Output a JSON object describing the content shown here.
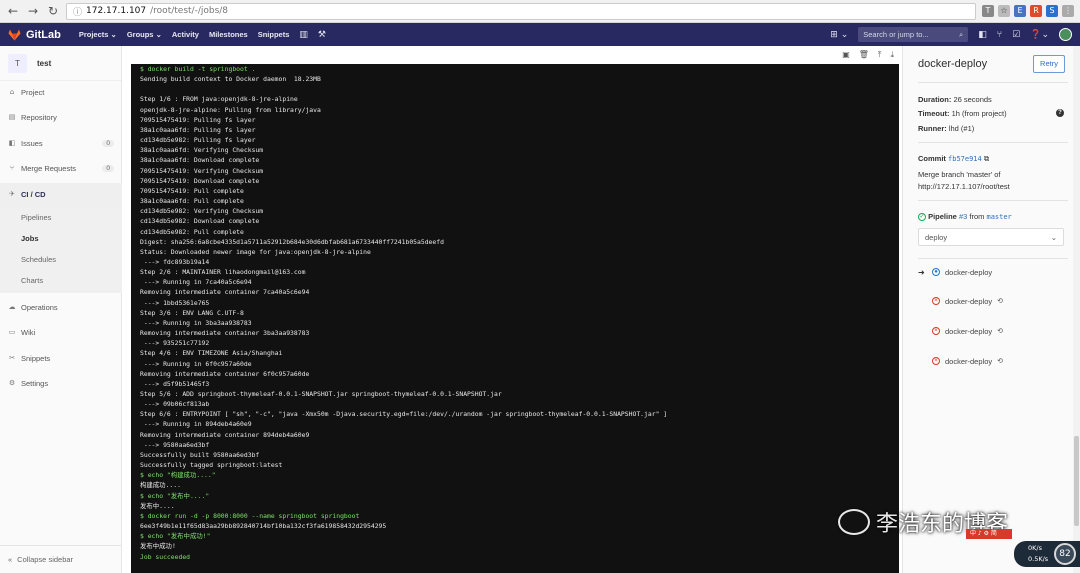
{
  "browser": {
    "url_host": "172.17.1.107",
    "url_path": "/root/test/-/jobs/8",
    "back_glyph": "←",
    "forward_glyph": "→",
    "reload_glyph": "↻"
  },
  "header": {
    "brand": "GitLab",
    "nav": [
      "Projects ⌄",
      "Groups ⌄",
      "Activity",
      "Milestones",
      "Snippets"
    ],
    "search_placeholder": "Search or jump to...",
    "accent": "#292961"
  },
  "sidebar": {
    "project_initial": "T",
    "project_name": "test",
    "items": [
      {
        "label": "Project",
        "icon": "house-icon"
      },
      {
        "label": "Repository",
        "icon": "book-icon"
      },
      {
        "label": "Issues",
        "icon": "issues-icon",
        "count": "0"
      },
      {
        "label": "Merge Requests",
        "icon": "merge-icon",
        "count": "0"
      },
      {
        "label": "CI / CD",
        "icon": "rocket-icon"
      },
      {
        "label": "Operations",
        "icon": "cloud-icon"
      },
      {
        "label": "Wiki",
        "icon": "wiki-icon"
      },
      {
        "label": "Snippets",
        "icon": "scissors-icon"
      },
      {
        "label": "Settings",
        "icon": "gear-icon"
      }
    ],
    "subitems": [
      "Pipelines",
      "Jobs",
      "Schedules",
      "Charts"
    ],
    "collapse_label": "Collapse sidebar"
  },
  "log": {
    "lines": [
      {
        "text": "$ docker build -t springboot .",
        "green": true
      },
      {
        "text": "Sending build context to Docker daemon  18.23MB",
        "green": false
      },
      {
        "text": "",
        "green": false
      },
      {
        "text": "Step 1/6 : FROM java:openjdk-8-jre-alpine",
        "green": false
      },
      {
        "text": "openjdk-8-jre-alpine: Pulling from library/java",
        "green": false
      },
      {
        "text": "709515475419: Pulling fs layer",
        "green": false
      },
      {
        "text": "38a1c0aaa6fd: Pulling fs layer",
        "green": false
      },
      {
        "text": "cd134db5e982: Pulling fs layer",
        "green": false
      },
      {
        "text": "38a1c0aaa6fd: Verifying Checksum",
        "green": false
      },
      {
        "text": "38a1c0aaa6fd: Download complete",
        "green": false
      },
      {
        "text": "709515475419: Verifying Checksum",
        "green": false
      },
      {
        "text": "709515475419: Download complete",
        "green": false
      },
      {
        "text": "709515475419: Pull complete",
        "green": false
      },
      {
        "text": "38a1c0aaa6fd: Pull complete",
        "green": false
      },
      {
        "text": "cd134db5e982: Verifying Checksum",
        "green": false
      },
      {
        "text": "cd134db5e982: Download complete",
        "green": false
      },
      {
        "text": "cd134db5e982: Pull complete",
        "green": false
      },
      {
        "text": "Digest: sha256:6a8cbe4335d1a5711a52912b684e30d6dbfab681a6733440ff7241b05a5deefd",
        "green": false
      },
      {
        "text": "Status: Downloaded newer image for java:openjdk-8-jre-alpine",
        "green": false
      },
      {
        "text": " ---> fdc893b19a14",
        "green": false
      },
      {
        "text": "Step 2/6 : MAINTAINER lihaodongmail@163.com",
        "green": false
      },
      {
        "text": " ---> Running in 7ca40a5c6e94",
        "green": false
      },
      {
        "text": "Removing intermediate container 7ca40a5c6e94",
        "green": false
      },
      {
        "text": " ---> 1bbd5361e765",
        "green": false
      },
      {
        "text": "Step 3/6 : ENV LANG C.UTF-8",
        "green": false
      },
      {
        "text": " ---> Running in 3ba3aa938783",
        "green": false
      },
      {
        "text": "Removing intermediate container 3ba3aa938783",
        "green": false
      },
      {
        "text": " ---> 935251c77192",
        "green": false
      },
      {
        "text": "Step 4/6 : ENV TIMEZONE Asia/Shanghai",
        "green": false
      },
      {
        "text": " ---> Running in 6f0c957a60de",
        "green": false
      },
      {
        "text": "Removing intermediate container 6f0c957a60de",
        "green": false
      },
      {
        "text": " ---> d5f9b51465f3",
        "green": false
      },
      {
        "text": "Step 5/6 : ADD springboot-thymeleaf-0.0.1-SNAPSHOT.jar springboot-thymeleaf-0.0.1-SNAPSHOT.jar",
        "green": false
      },
      {
        "text": " ---> 09b06cf813ab",
        "green": false
      },
      {
        "text": "Step 6/6 : ENTRYPOINT [ \"sh\", \"-c\", \"java -Xmx50m -Djava.security.egd=file:/dev/./urandom -jar springboot-thymeleaf-0.0.1-SNAPSHOT.jar\" ]",
        "green": false
      },
      {
        "text": " ---> Running in 894deb4a60e9",
        "green": false
      },
      {
        "text": "Removing intermediate container 894deb4a60e9",
        "green": false
      },
      {
        "text": " ---> 9580aa6ed3bf",
        "green": false
      },
      {
        "text": "Successfully built 9580aa6ed3bf",
        "green": false
      },
      {
        "text": "Successfully tagged springboot:latest",
        "green": false
      },
      {
        "text": "$ echo \"构建成功....\"",
        "green": true
      },
      {
        "text": "构建成功....",
        "green": false
      },
      {
        "text": "$ echo \"发布中....\"",
        "green": true
      },
      {
        "text": "发布中....",
        "green": false
      },
      {
        "text": "$ docker run -d -p 8000:8000 --name springboot springboot",
        "green": true
      },
      {
        "text": "6ee3f49b1e11f65d83aa29bb892840714bf10ba132cf3fa619858432d2954295",
        "green": false
      },
      {
        "text": "$ echo \"发布中成功!\"",
        "green": true
      },
      {
        "text": "发布中成功!",
        "green": false
      },
      {
        "text": "Job succeeded",
        "green": true
      }
    ]
  },
  "job": {
    "title": "docker-deploy",
    "retry_label": "Retry",
    "duration_label": "Duration:",
    "duration_value": "26 seconds",
    "timeout_label": "Timeout:",
    "timeout_value": "1h (from project)",
    "runner_label": "Runner:",
    "runner_value": "lhd (#1)",
    "commit_label": "Commit",
    "commit_sha": "fb57e914",
    "commit_msg_1": "Merge branch 'master' of",
    "commit_msg_2": "http://172.17.1.107/root/test",
    "pipeline_label": "Pipeline",
    "pipeline_id": "#3",
    "pipeline_from": "from",
    "pipeline_ref": "master",
    "stage": "deploy",
    "jobs": [
      {
        "name": "docker-deploy",
        "current": true
      },
      {
        "name": "docker-deploy",
        "current": false
      },
      {
        "name": "docker-deploy",
        "current": false
      },
      {
        "name": "docker-deploy",
        "current": false
      }
    ]
  },
  "overlay": {
    "watermark": "李浩东的博客",
    "net_up": "0K/s",
    "net_down": "0.5K/s",
    "cpu": "82",
    "badge_text": "中 ♪ ⚙ 简"
  }
}
